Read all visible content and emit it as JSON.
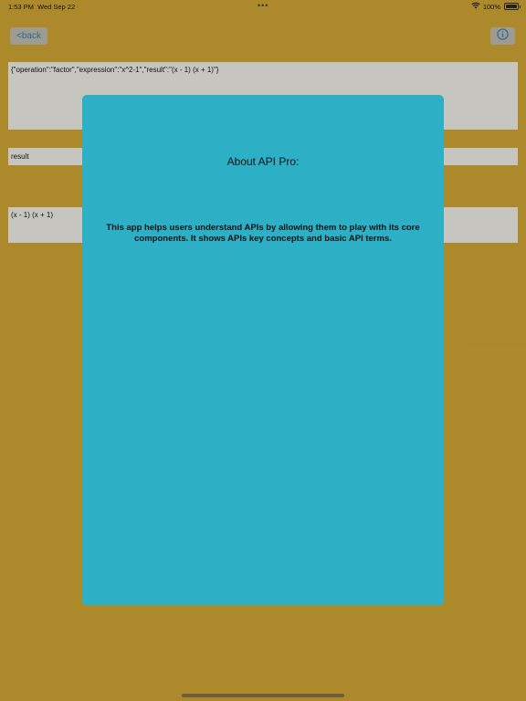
{
  "status_bar": {
    "time": "1:53 PM",
    "date": "Wed Sep 22",
    "dots": "•••",
    "battery_percent": "100%",
    "battery_level": 1.0
  },
  "nav": {
    "back_label": "<back",
    "info_icon": "info-circle-icon"
  },
  "request": {
    "json_text": "{\"operation\":\"factor\",\"expression\":\"x^2-1\",\"result\":\"(x - 1) (x + 1)\"}",
    "key_field_value": "result",
    "output_value": "(x - 1) (x + 1)"
  },
  "about_modal": {
    "title": "About API Pro:",
    "body": "This app helps users understand APIs by allowing them to play with its core components. It shows APIs key concepts and basic API terms."
  },
  "colors": {
    "background": "#b5912e",
    "modal": "#2db0c6",
    "panel": "#d2d0cd",
    "link_blue": "#2f6fa8"
  }
}
